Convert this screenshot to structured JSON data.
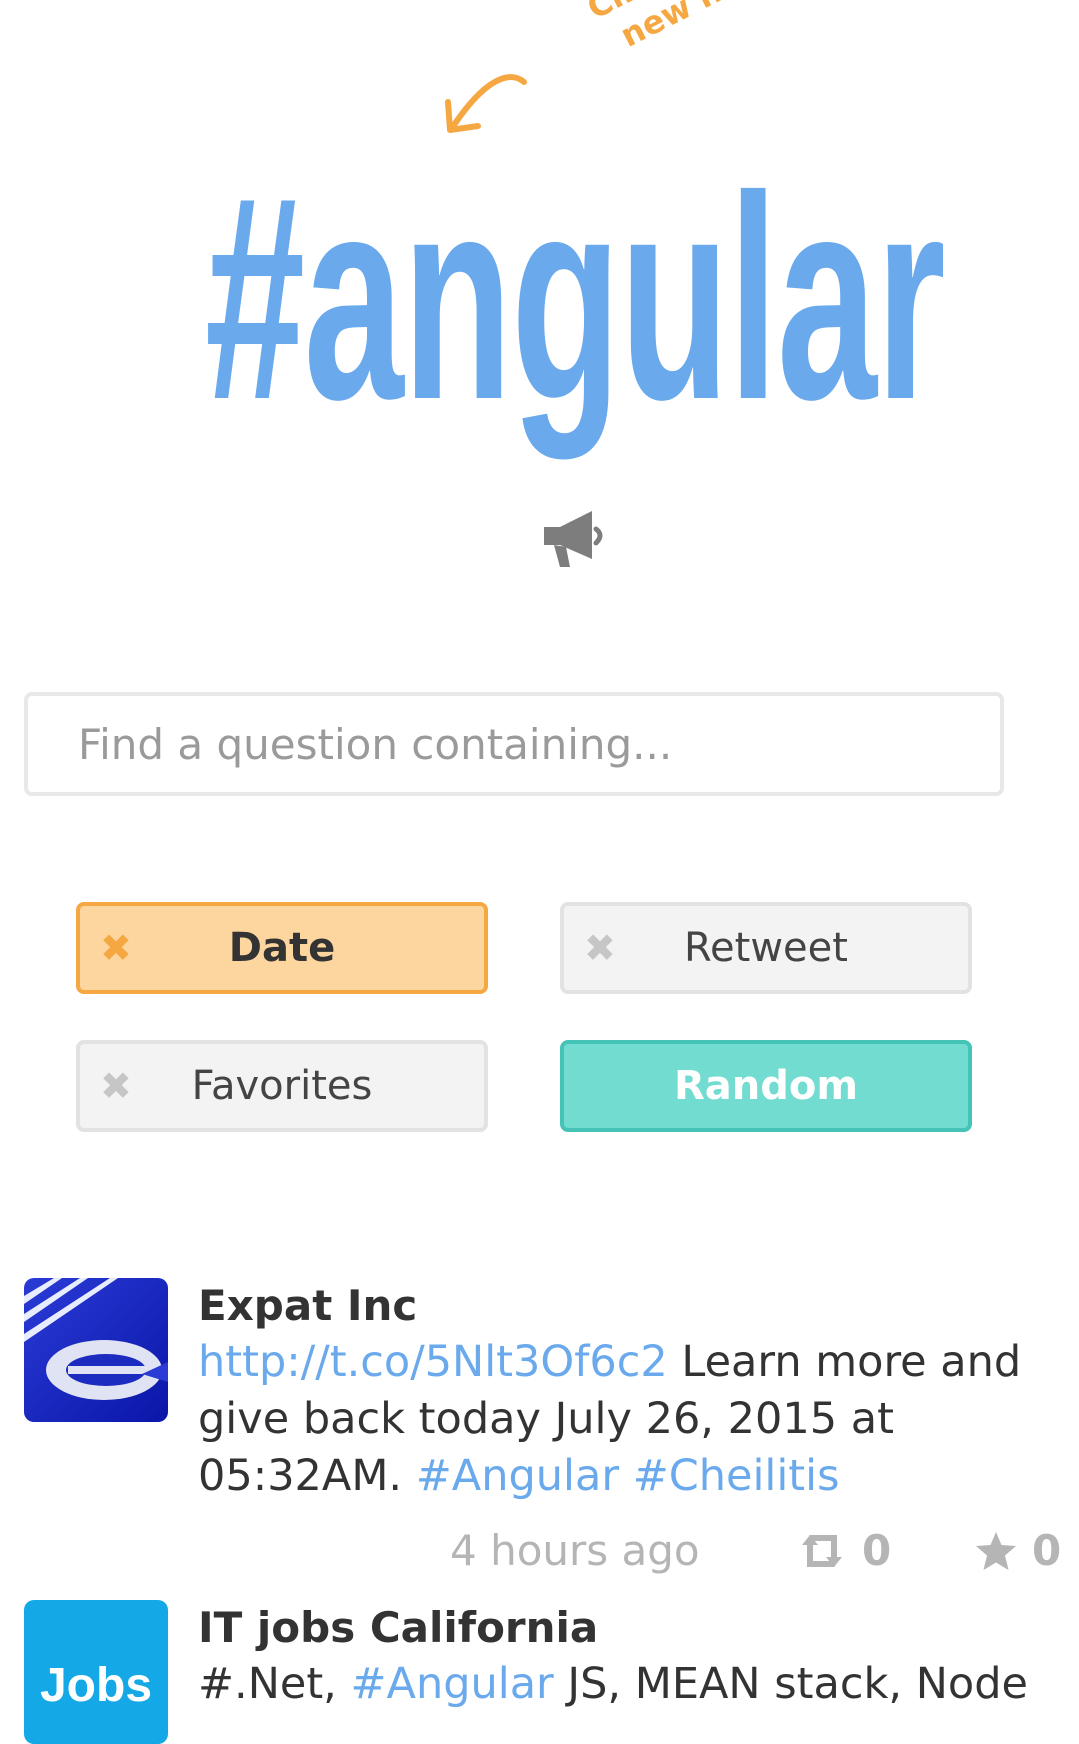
{
  "header": {
    "hint_text": "Click to search new hashtag",
    "hashtag": "#angular"
  },
  "search": {
    "placeholder": "Find a question containing..."
  },
  "sort_buttons": {
    "date": "Date",
    "retweet": "Retweet",
    "favorites": "Favorites",
    "random": "Random",
    "remove_glyph": "✖"
  },
  "colors": {
    "accent_blue": "#6aa9ec",
    "accent_orange": "#f5a742",
    "random_teal": "#72dcd1"
  },
  "tweets": [
    {
      "author": "Expat Inc",
      "link": "http://t.co/5Nlt3Of6c2",
      "text": " Learn more and give back today July 26, 2015 at 05:32AM. ",
      "tags": [
        "#Angular",
        "#Cheilitis"
      ],
      "time": "4 hours ago",
      "retweets": "0",
      "favorites": "0",
      "avatar_icon": "expat-logo-icon"
    },
    {
      "author": "IT jobs California",
      "text_start": "#.Net, ",
      "tag": "#Angular",
      "text_end": " JS, MEAN stack, Node",
      "avatar_label": "Jobs",
      "avatar_icon": "jobs-logo-icon"
    }
  ]
}
